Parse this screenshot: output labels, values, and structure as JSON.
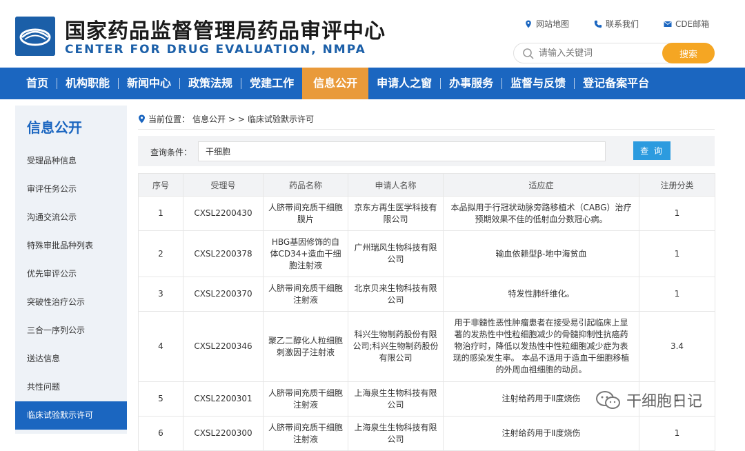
{
  "header": {
    "title_cn": "国家药品监督管理局药品审评中心",
    "title_en": "CENTER FOR DRUG EVALUATION, NMPA",
    "links": [
      "网站地图",
      "联系我们",
      "CDE邮箱"
    ],
    "search_placeholder": "请输入关键词",
    "search_button": "搜索"
  },
  "nav": {
    "items": [
      "首页",
      "机构职能",
      "新闻中心",
      "政策法规",
      "党建工作",
      "信息公开",
      "申请人之窗",
      "办事服务",
      "监督与反馈",
      "登记备案平台"
    ],
    "active_index": 5
  },
  "sidebar": {
    "title": "信息公开",
    "items": [
      "受理品种信息",
      "审评任务公示",
      "沟通交流公示",
      "特殊审批品种列表",
      "优先审评公示",
      "突破性治疗公示",
      "三合一序列公示",
      "送达信息",
      "共性问题",
      "临床试验默示许可"
    ],
    "active_index": 9
  },
  "breadcrumb": {
    "prefix": "当前位置：",
    "section": "信息公开",
    "separator": "> >",
    "page": "临床试验默示许可"
  },
  "query": {
    "label": "查询条件：",
    "value": "干细胞",
    "button": "查 询"
  },
  "table": {
    "headers": [
      "序号",
      "受理号",
      "药品名称",
      "申请人名称",
      "适应症",
      "注册分类"
    ],
    "rows": [
      [
        "1",
        "CXSL2200430",
        "人脐带间充质干细胞膜片",
        "京东方再生医学科技有限公司",
        "本品拟用于行冠状动脉旁路移植术（CABG）治疗预期效果不佳的低射血分数冠心病。",
        "1"
      ],
      [
        "2",
        "CXSL2200378",
        "HBG基因修饰的自体CD34+造血干细胞注射液",
        "广州瑞风生物科技有限公司",
        "输血依赖型β-地中海贫血",
        "1"
      ],
      [
        "3",
        "CXSL2200370",
        "人脐带间充质干细胞注射液",
        "北京贝来生物科技有限公司",
        "特发性肺纤维化。",
        "1"
      ],
      [
        "4",
        "CXSL2200346",
        "聚乙二醇化人粒细胞刺激因子注射液",
        "科兴生物制药股份有限公司;科兴生物制药股份有限公司",
        "用于非髓性恶性肿瘤患者在接受易引起临床上显著的发热性中性粒细胞减少的骨髓抑制性抗癌药物治疗时，降低以发热性中性粒细胞减少症为表现的感染发生率。 本品不适用于造血干细胞移植的外周血祖细胞的动员。",
        "3.4"
      ],
      [
        "5",
        "CXSL2200301",
        "人脐带间充质干细胞注射液",
        "上海泉生生物科技有限公司",
        "注射给药用于Ⅱ度烧伤",
        "1"
      ],
      [
        "6",
        "CXSL2200300",
        "人脐带间充质干细胞注射液",
        "上海泉生生物科技有限公司",
        "注射给药用于Ⅱ度烧伤",
        "1"
      ]
    ]
  },
  "watermark": "干细胞日记",
  "colors": {
    "nav_blue": "#1b66c0",
    "nav_active": "#e99a3a",
    "search_button": "#f5a623",
    "query_button": "#2c9bdf"
  }
}
